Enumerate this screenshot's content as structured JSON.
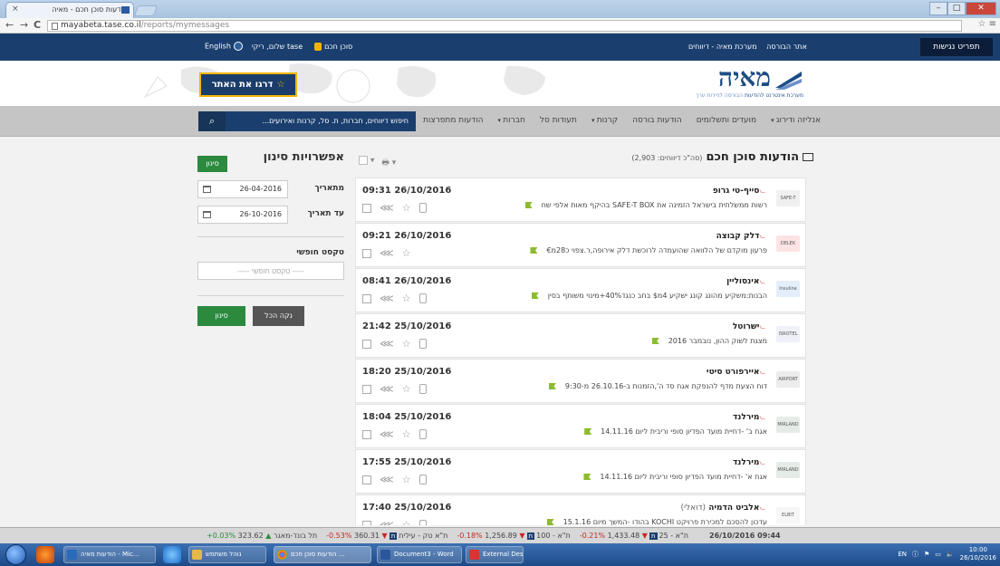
{
  "browser": {
    "tab_title": "הודעות סוכן חכם - מאיה",
    "tab_close": "×",
    "url_host": "mayabeta.tase.co.il",
    "url_path": "/reports/mymessages",
    "back": "←",
    "forward": "→",
    "reload": "C"
  },
  "topbar": {
    "trading_hours": "תפריט נגישות",
    "link_tase": "אתר הבורסה",
    "link_maya": "מערכת מאיה - דיווחים",
    "smart_agent": "סוכן חכם",
    "greeting": "שלום, ריקי tase",
    "english": "English"
  },
  "hero": {
    "logo_title": "מאיה",
    "logo_sub_tase": "הבורסה לניירות ערך",
    "logo_sub_system": "מערכת אינטרנט להודעות",
    "tour_button": "דרגו את האתר"
  },
  "menu": {
    "items": [
      "הודעות מתפרצות",
      "חברות",
      "תעודות סל",
      "קרנות",
      "הודעות בורסה",
      "מועדים ותשלומים",
      "אנליזה ודירוג"
    ],
    "search_placeholder": "חיפוש דיווחים, חברות, ת. סל, קרנות ואירועים..."
  },
  "page": {
    "title": "הודעות סוכן חכם",
    "count": "(סה\"כ דיווחים: 2,903)"
  },
  "filter": {
    "title": "אפשרויות סינון",
    "sort_button": "סינון",
    "from_label": "מתאריך",
    "from_value": "26-04-2016",
    "to_label": "עד תאריך",
    "to_value": "26-10-2016",
    "free_text_label": "טקסט חופשי",
    "free_text_placeholder": "----- טקסט חופשי -----",
    "clear_button": "נקה הכל",
    "apply_button": "סינון"
  },
  "messages": [
    {
      "time": "09:31 26/10/2016",
      "company": "סייף-טי גרופ",
      "note": "",
      "text": "רשות ממשלתית בישראל הזמינה את SAFE-T BOX בהיקף מאות אלפי שח",
      "logo": "SAFE-T",
      "logo_color": "#f0f0f0"
    },
    {
      "time": "09:21 26/10/2016",
      "company": "דלק קבוצה",
      "note": "",
      "text": "פרעון מוקדם של הלוואה שהועמדה לרוכשת דלק אירופה,ר.צפוי כ28מ€",
      "logo": "DELEK",
      "logo_color": "#fde3e3"
    },
    {
      "time": "08:41 26/10/2016",
      "company": "אינסוליין",
      "note": "",
      "text": "הבנות:משקיע מהונג קונג ישקיע 4מ$ בחב כנגד40%+מינוי משותף בסין",
      "logo": "Insuline",
      "logo_color": "#e3eefa"
    },
    {
      "time": "21:42 25/10/2016",
      "company": "ישרוטל",
      "note": "",
      "text": "מצגת לשוק ההון, נובמבר 2016",
      "logo": "ISROTEL",
      "logo_color": "#eef1f8"
    },
    {
      "time": "18:20 25/10/2016",
      "company": "איירפורט סיטי",
      "note": "",
      "text": "דוח הצעת מדף להנפקת אגח סד ה',הזמנות ב-26.10.16 מ-9:30",
      "logo": "AIRPORT",
      "logo_color": "#ececec"
    },
    {
      "time": "18:04 25/10/2016",
      "company": "מירלנד",
      "note": "",
      "text": "אגח ב' -דחיית מועד הפדיון סופי וריבית ליום 14.11.16",
      "logo": "MIRLAND",
      "logo_color": "#e5ece8"
    },
    {
      "time": "17:55 25/10/2016",
      "company": "מירלנד",
      "note": "",
      "text": "אגח א' -דחיית מועד הפדיון סופי וריבית ליום 14.11.16",
      "logo": "MIRLAND",
      "logo_color": "#e5ece8"
    },
    {
      "time": "17:40 25/10/2016",
      "company": "אלביט הדמיה",
      "note": "(דואלי)",
      "text": "עדכון להסכם למכירת פרויקט KOCHI בהודו -המשך מיום 15.1.16",
      "logo": "ELBIT",
      "logo_color": "#f6f6f6"
    }
  ],
  "ticker": {
    "datetime": "26/10/2016 09:44",
    "items": [
      {
        "name": "ת\"א - 25",
        "value": "1,433.48",
        "change": "-0.21%",
        "dir": "down"
      },
      {
        "name": "ת\"א - 100",
        "value": "1,256.89",
        "change": "-0.18%",
        "dir": "down"
      },
      {
        "name": "ת\"א טק - עילית",
        "value": "360.31",
        "change": "-0.53%",
        "dir": "down"
      },
      {
        "name": "תל בונד-מאגר",
        "value": "323.62",
        "change": "+0.03%",
        "dir": "up"
      }
    ]
  },
  "taskbar": {
    "tasks": [
      "הודעות מאיה - Mic...",
      "נוהל משתמש",
      "הודעות סוכן חכם ...",
      "Document3 - Word",
      "External Desktop"
    ],
    "lang": "EN",
    "time": "10:00",
    "date": "26/10/2016"
  }
}
